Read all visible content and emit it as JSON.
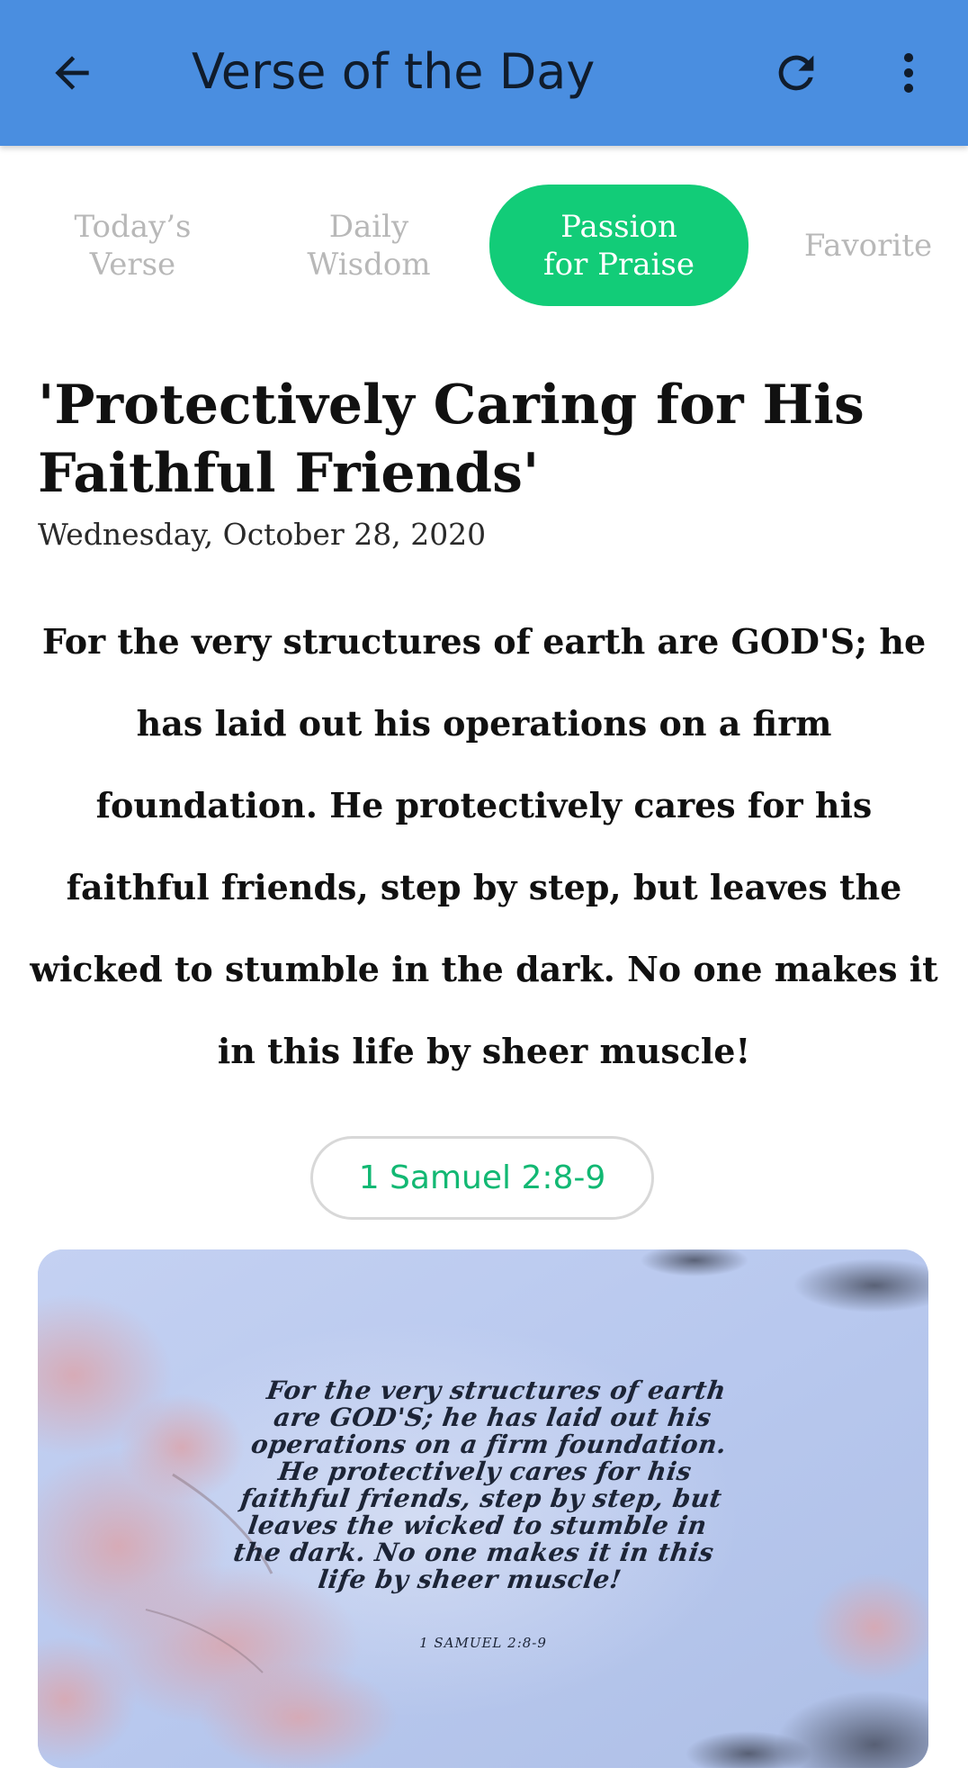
{
  "app_bar": {
    "title": "Verse of the Day",
    "back_icon": "arrow-left-icon",
    "refresh_icon": "refresh-icon",
    "more_icon": "more-vertical-icon",
    "background_color": "#4a8ee0"
  },
  "tabs": [
    {
      "label_line1": "Today’s",
      "label_line2": "Verse",
      "selected": false
    },
    {
      "label_line1": "Daily",
      "label_line2": "Wisdom",
      "selected": false
    },
    {
      "label_line1": "Passion",
      "label_line2": "for Praise",
      "selected": true
    },
    {
      "label_line1": "Favorite",
      "label_line2": "",
      "selected": false
    }
  ],
  "active_tab_color": "#12cc78",
  "verse": {
    "title": "'Protectively Caring for His Faithful Friends'",
    "date": "Wednesday, October 28, 2020",
    "text": "For the very structures of earth are GOD'S; he has laid out his operations on a firm foundation. He protectively cares for his faithful friends, step by step, but leaves the wicked to stumble in the dark. No one makes it in this life by sheer muscle!",
    "reference": "1 Samuel 2:8-9",
    "reference_color": "#12b873"
  },
  "image": {
    "text": "For the very structures of earth are GOD'S; he has laid out his operations on a firm foundation. He protectively cares for his faithful friends, step by step, but leaves the wicked to stumble in the dark. No one makes it in this life by sheer muscle!",
    "reference": "1 SAMUEL 2:8-9"
  }
}
